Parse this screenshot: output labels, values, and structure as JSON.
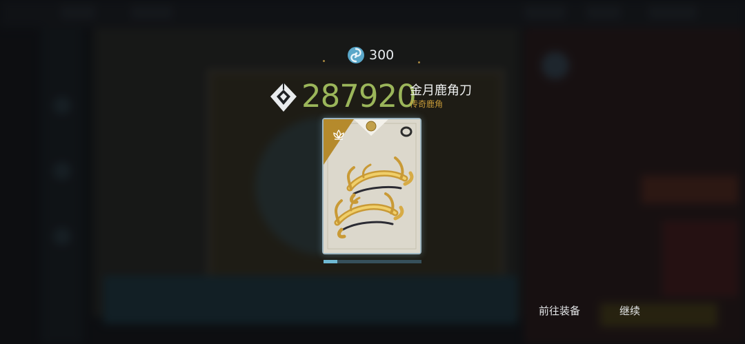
{
  "currency": {
    "icon": "swirl-icon",
    "value": "300"
  },
  "reward": {
    "score": "287920",
    "item_name": "金月鹿角刀",
    "rarity": "传奇鹿角",
    "rarity_color": "#c69a38",
    "score_color": "#9bb65a"
  },
  "card": {
    "tier_icon": "lotus-icon",
    "gem_icon": "gem-icon",
    "type_icon": "ring-icon",
    "art": "golden-antler-blades-art"
  },
  "progress": {
    "fraction": 0.14
  },
  "actions": {
    "equip_label": "前往装备",
    "continue_label": "继续"
  }
}
